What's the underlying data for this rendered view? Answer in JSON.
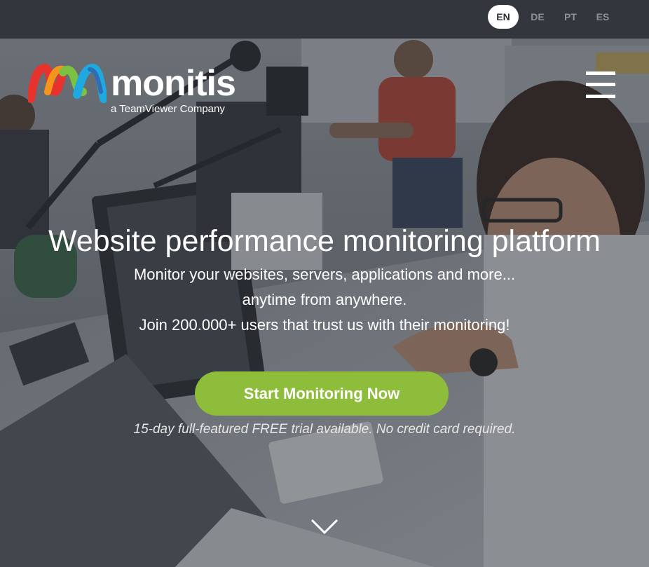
{
  "languages": {
    "items": [
      "EN",
      "DE",
      "PT",
      "ES"
    ],
    "active": "EN"
  },
  "brand": {
    "name": "monitis",
    "tagline": "a TeamViewer Company",
    "logo_colors": [
      "#e8322e",
      "#f7941d",
      "#7cc242",
      "#1fa9e1",
      "#2e6db4"
    ]
  },
  "header": {
    "menu_icon": "hamburger-menu-icon"
  },
  "hero": {
    "headline": "Website performance monitoring platform",
    "line1": "Monitor your websites, servers, applications and more...",
    "line2": "anytime from anywhere.",
    "line3": "Join 200.000+ users that trust us with their monitoring!",
    "cta_label": "Start Monitoring Now",
    "trial_note": "15-day full-featured FREE trial available. No credit card required.",
    "scroll_icon": "chevron-down-icon"
  },
  "colors": {
    "topbar": "#33363d",
    "cta": "#8dbd3a",
    "active_lang_bg": "#ffffff",
    "inactive_lang": "#8d9097"
  }
}
